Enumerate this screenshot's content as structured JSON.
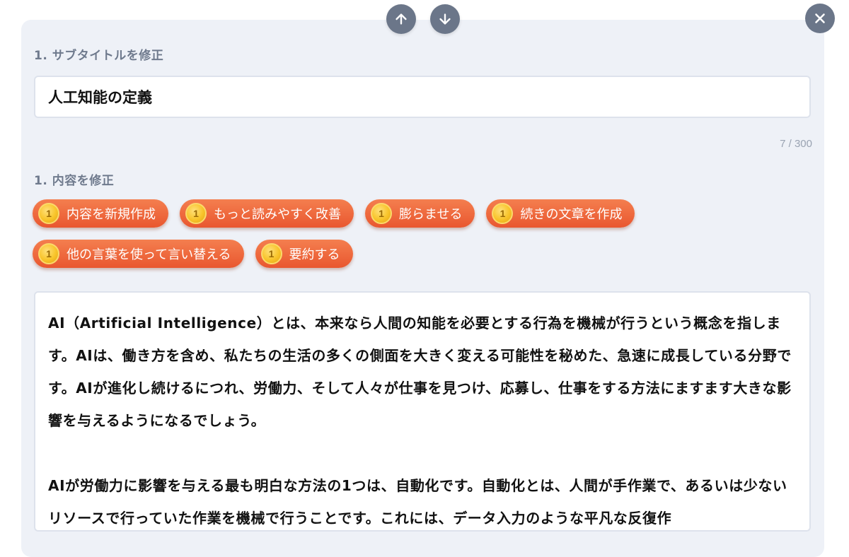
{
  "nav": {
    "up_icon": "arrow-up-icon",
    "down_icon": "arrow-down-icon",
    "close_icon": "close-icon"
  },
  "subtitle_section": {
    "label": "1. サブタイトルを修正",
    "value": "人工知能の定義",
    "counter": "7 / 300"
  },
  "content_section": {
    "label": "1. 内容を修正",
    "actions_row1": [
      {
        "cost": "1",
        "label": "内容を新規作成"
      },
      {
        "cost": "1",
        "label": "もっと読みやすく改善"
      },
      {
        "cost": "1",
        "label": "膨らませる"
      },
      {
        "cost": "1",
        "label": "続きの文章を作成"
      }
    ],
    "actions_row2": [
      {
        "cost": "1",
        "label": "他の言葉を使って言い替える"
      },
      {
        "cost": "1",
        "label": "要約する"
      }
    ],
    "paragraphs": [
      "AI（Artificial Intelligence）とは、本来なら人間の知能を必要とする行為を機械が行うという概念を指します。AIは、働き方を含め、私たちの生活の多くの側面を大きく変える可能性を秘めた、急速に成長している分野です。AIが進化し続けるにつれ、労働力、そして人々が仕事を見つけ、応募し、仕事をする方法にますます大きな影響を与えるようになるでしょう。",
      "AIが労働力に影響を与える最も明白な方法の1つは、自動化です。自動化とは、人間が手作業で、あるいは少ないリソースで行っていた作業を機械で行うことです。これには、データ入力のような平凡な反復作"
    ]
  },
  "colors": {
    "panel": "#eef1f7",
    "chip_gradient_top": "#f47f4f",
    "chip_gradient_bottom": "#e9572f",
    "nav_button": "#6b7689"
  }
}
